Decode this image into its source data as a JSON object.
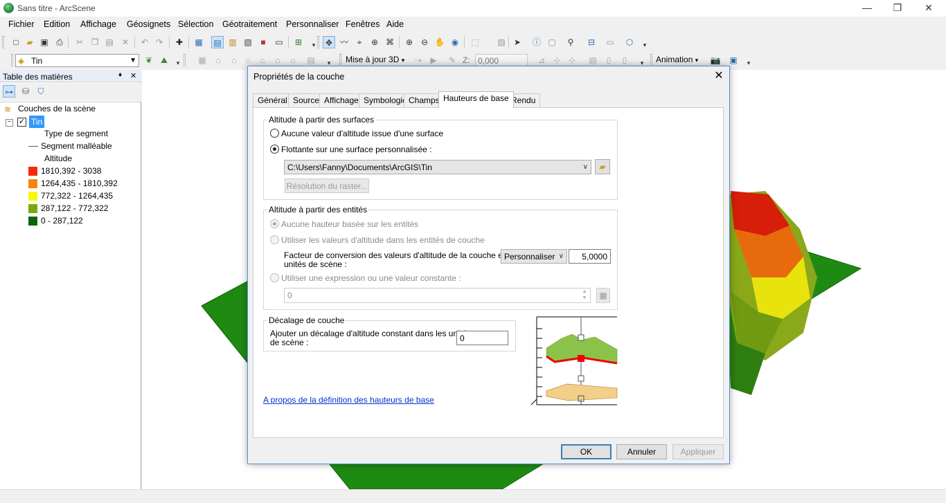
{
  "window": {
    "title": "Sans titre - ArcScene",
    "min": "—",
    "max": "❐",
    "close": "✕"
  },
  "menu": [
    "Fichier",
    "Edition",
    "Affichage",
    "Géosignets",
    "Sélection",
    "Géotraitement",
    "Personnaliser",
    "Fenêtres",
    "Aide"
  ],
  "toolbar2": {
    "layer_select": "Tin",
    "update_label": "Mise à jour 3D",
    "z_label": "Z:",
    "z_value": "0,000",
    "animation_label": "Animation"
  },
  "toc": {
    "title": "Table des matières",
    "pin": "♦",
    "close": "✕",
    "root": "Couches de la scène",
    "layer": "Tin",
    "layer_checked": "✓",
    "expand": "−",
    "legend": {
      "type_segment": "Type de segment",
      "segment_malleable": "Segment malléable",
      "altitude": "Altitude",
      "classes": [
        {
          "label": "1810,392 - 3038",
          "color": "#f42a0a"
        },
        {
          "label": "1264,435 - 1810,392",
          "color": "#f5870a"
        },
        {
          "label": "772,322 - 1264,435",
          "color": "#f7f70f"
        },
        {
          "label": "287,122 - 772,322",
          "color": "#79a90f"
        },
        {
          "label": "0 - 287,122",
          "color": "#0b650b"
        }
      ]
    }
  },
  "dialog": {
    "title": "Propriétés de la couche",
    "tabs": [
      "Général",
      "Source",
      "Affichage",
      "Symbologie",
      "Champs",
      "Hauteurs de base",
      "Rendu"
    ],
    "active_tab": "Hauteurs de base",
    "surfaces_group": {
      "title": "Altitude à partir des surfaces",
      "option_none": "Aucune valeur d'altitude issue d'une surface",
      "option_custom": "Flottante sur une surface personnalisée :",
      "path": "C:\\Users\\Fanny\\Documents\\ArcGIS\\Tin",
      "raster_button": "Résolution du raster..."
    },
    "features_group": {
      "title": "Altitude à partir des entités",
      "option_none": "Aucune hauteur basée sur les entités",
      "option_values": "Utiliser les valeurs d'altitude dans les entités de couche",
      "factor_label_1": "Facteur de conversion des valeurs d'altitude de la couche en",
      "factor_label_2": "unités de scène :",
      "factor_unit": "Personnaliser",
      "factor_value": "5,0000",
      "option_expression": "Utiliser une expression ou une valeur constante :",
      "expression_value": "0"
    },
    "offset_group": {
      "title": "Décalage de couche",
      "label_1": "Ajouter un décalage d'altitude constant dans les unités",
      "label_2": "de scène :",
      "value": "0"
    },
    "help_link": "A propos de la définition des hauteurs de base",
    "buttons": {
      "ok": "OK",
      "cancel": "Annuler",
      "apply": "Appliquer"
    }
  }
}
